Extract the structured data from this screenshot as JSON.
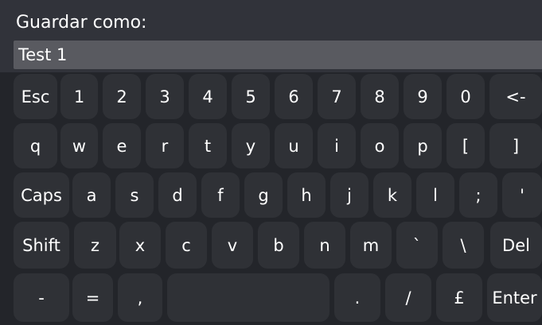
{
  "dialog": {
    "title": "Guardar como:",
    "input_value": "Test 1"
  },
  "colors": {
    "background": "#31333a",
    "keyboard_background": "#23252a",
    "key": "#2f3136",
    "input": "#595a60",
    "text": "#ffffff"
  },
  "keyboard": {
    "rows": [
      [
        "Esc",
        "1",
        "2",
        "3",
        "4",
        "5",
        "6",
        "7",
        "8",
        "9",
        "0",
        "<-"
      ],
      [
        "q",
        "w",
        "e",
        "r",
        "t",
        "y",
        "u",
        "i",
        "o",
        "p",
        "[",
        "]"
      ],
      [
        "Caps",
        "a",
        "s",
        "d",
        "f",
        "g",
        "h",
        "j",
        "k",
        "l",
        ";",
        "'"
      ],
      [
        "Shift",
        "z",
        "x",
        "c",
        "v",
        "b",
        "n",
        "m",
        "`",
        "\\",
        "Del"
      ],
      [
        "-",
        "=",
        ",",
        "",
        ".",
        "/",
        "£",
        "Enter"
      ]
    ]
  }
}
